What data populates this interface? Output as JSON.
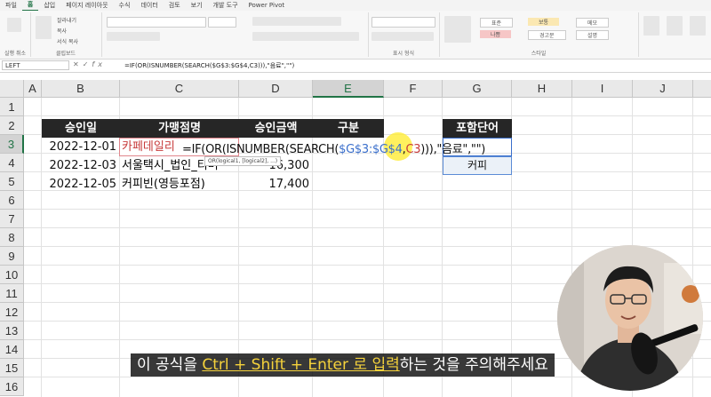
{
  "menu": {
    "tabs": [
      "파일",
      "홈",
      "삽입",
      "페이지 레이아웃",
      "수식",
      "데이터",
      "검토",
      "보기",
      "개발 도구",
      "Power Pivot"
    ],
    "active_index": 1
  },
  "ribbon": {
    "groups": [
      "클립보드",
      "표시 형식",
      "스타일"
    ],
    "undo_label": "실행 취소",
    "paste_items": [
      "잘라내기",
      "복사",
      "서식 복사"
    ],
    "style_cells": [
      "표준",
      "나쁨",
      "보통",
      "메모",
      "좋음",
      "경고문",
      "설명"
    ]
  },
  "formula_bar": {
    "name_box": "LEFT",
    "fx": "fx",
    "formula": "=IF(OR(ISNUMBER(SEARCH($G$3:$G$4,C3))),\"음료\",\"\")"
  },
  "columns": [
    "A",
    "B",
    "C",
    "D",
    "E",
    "F",
    "G",
    "H",
    "I",
    "J"
  ],
  "rows": [
    "1",
    "2",
    "3",
    "4",
    "5",
    "6",
    "7",
    "8",
    "9",
    "10",
    "11",
    "12",
    "13",
    "14",
    "15",
    "16"
  ],
  "table": {
    "headers": [
      "승인일",
      "가맹점명",
      "승인금액",
      "구분"
    ],
    "rows": [
      {
        "date": "2022-12-01",
        "merchant": "카페데일리",
        "amount": ""
      },
      {
        "date": "2022-12-03",
        "merchant": "서울택시_법인_티머",
        "amount": "16,300"
      },
      {
        "date": "2022-12-05",
        "merchant": "커피빈(영등포점)",
        "amount": "17,400"
      }
    ]
  },
  "keyword_table": {
    "header": "포함단어",
    "values": [
      "",
      "커피"
    ]
  },
  "editing_formula": {
    "prefix": "=IF(OR(ISNUMBER(SEARCH(",
    "range": "$G$3:$G$4",
    "sep": ",",
    "ref": "C3",
    "suffix": ")))",
    "tail": ",\"음료\",\"\")"
  },
  "tooltip": "OR(logical1, [logical2], ...)",
  "subtitle": {
    "before": "이 공식을 ",
    "highlight": "Ctrl + Shift + Enter 로 입력",
    "after": "하는 것을 주의해주세요"
  },
  "colors": {
    "excel_green": "#217346",
    "header_dark": "#262626",
    "range_blue": "#3a6fcc",
    "ref_red": "#c73a3a",
    "subtitle_yellow": "#f5d23b"
  }
}
